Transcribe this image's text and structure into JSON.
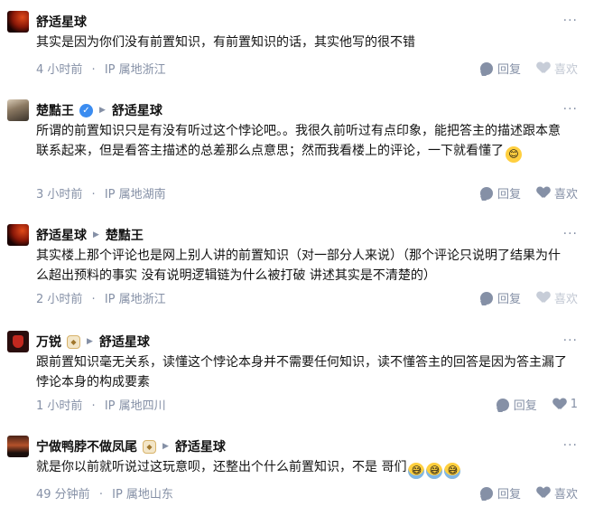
{
  "comments": [
    {
      "author": "舒适星球",
      "reply_to": "",
      "text": "其实是因为你们没有前置知识，有前置知识的话，其实他写的很不错",
      "time": "4 小时前",
      "location": "IP 属地浙江",
      "reply_label": "回复",
      "like_label": "喜欢"
    },
    {
      "author": "楚黠王",
      "reply_to": "舒适星球",
      "text": "所谓的前置知识只是有没有听过这个悖论吧。。我很久前听过有点印象，能把答主的描述跟本意联系起来，但是看答主描述的总差那么点意思；然而我看楼上的评论，一下就看懂了",
      "time": "3 小时前",
      "location": "IP 属地湖南",
      "reply_label": "回复",
      "like_label": "喜欢"
    },
    {
      "author": "舒适星球",
      "reply_to": "楚黠王",
      "text": "其实楼上那个评论也是网上别人讲的前置知识（对一部分人来说）（那个评论只说明了结果为什么超出预料的事实 没有说明逻辑链为什么被打破 讲述其实是不清楚的）",
      "time": "2 小时前",
      "location": "IP 属地浙江",
      "reply_label": "回复",
      "like_label": "喜欢"
    },
    {
      "author": "万锐",
      "reply_to": "舒适星球",
      "text": "跟前置知识毫无关系，读懂这个悖论本身并不需要任何知识，读不懂答主的回答是因为答主漏了悖论本身的构成要素",
      "time": "1 小时前",
      "location": "IP 属地四川",
      "reply_label": "回复",
      "like_label": "1"
    },
    {
      "author": "宁做鸭脖不做凤尾",
      "reply_to": "舒适星球",
      "text": "就是你以前就听说过这玩意呗，还整出个什么前置知识，不是 哥们",
      "time": "49 分钟前",
      "location": "IP 属地山东",
      "reply_label": "回复",
      "like_label": "喜欢"
    }
  ],
  "icons": {
    "more": "more-dots-icon",
    "reply": "comment-bubble-icon",
    "like": "heart-icon",
    "verified": "verified-check-icon",
    "badge": "member-badge-icon",
    "reply_arrow": "triangle-right-icon"
  },
  "colors": {
    "text": "#121212",
    "meta": "#8590a6",
    "verified": "#3b8cf0"
  }
}
